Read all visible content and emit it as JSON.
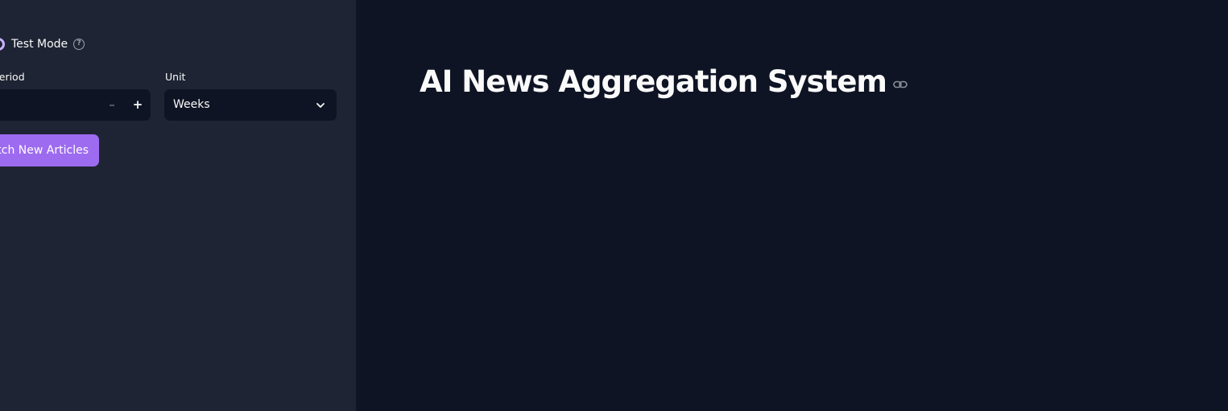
{
  "sidebar": {
    "test_mode_label": "Test Mode",
    "time_period_label": "e Period",
    "unit_label": "Unit",
    "unit_selected": "Weeks",
    "stepper_minus": "–",
    "stepper_plus": "+",
    "fetch_button_label": "etch New Articles",
    "help_icon": "question-circle-icon"
  },
  "main": {
    "title": "AI News Aggregation System",
    "anchor_icon": "link-icon"
  },
  "colors": {
    "sidebar_bg": "#1e2433",
    "main_bg": "#0e1424",
    "accent": "#9d6bf0"
  }
}
